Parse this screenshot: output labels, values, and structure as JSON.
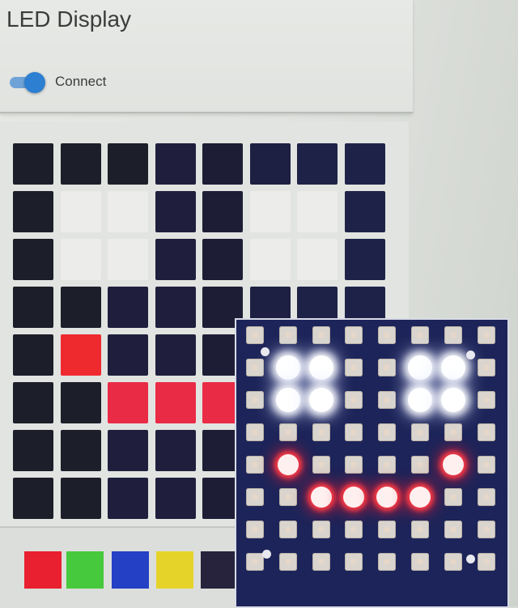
{
  "app": {
    "title": "LED Display",
    "connect_label": "Connect",
    "connect_on": true
  },
  "grid": {
    "rows": 8,
    "cols": 8,
    "colors": [
      [
        "#1c1e29",
        "#1c1e29",
        "#1c1e29",
        "#1f1f3d",
        "#1d1d36",
        "#1d2042",
        "#1e2247",
        "#1f2248"
      ],
      [
        "#1c1e29",
        "#ececea",
        "#ececea",
        "#1f1f3d",
        "#1d1d36",
        "#ececea",
        "#ececea",
        "#1f2248"
      ],
      [
        "#1c1e29",
        "#ececea",
        "#ececea",
        "#1f1f3d",
        "#1d1d36",
        "#ececea",
        "#ececea",
        "#1f2248"
      ],
      [
        "#1c1e29",
        "#1c1e29",
        "#1f1f3d",
        "#1f1f3d",
        "#1d1d36",
        "#1d2042",
        "#1e2247",
        "#1f2248"
      ],
      [
        "#1c1e29",
        "#ef2a2f",
        "#1f1f3d",
        "#1f1f3d",
        "#1d1d36",
        "#1d2042",
        "#ef2a2f",
        "#1f2248"
      ],
      [
        "#1c1e29",
        "#1c1e29",
        "#ea2b45",
        "#ea2b45",
        "#ea2b45",
        "#ea2b45",
        "#1e2247",
        "#1f2248"
      ],
      [
        "#1c1e29",
        "#1c1e29",
        "#1f1f3d",
        "#1f1f3d",
        "#1d1d36",
        "#1d2042",
        "#1e2247",
        "#1f2248"
      ],
      [
        "#1c1e29",
        "#1c1e29",
        "#1f1f3d",
        "#1f1f3d",
        "#1d1d36",
        "#1d2042",
        "#1e2247",
        "#1f2248"
      ]
    ]
  },
  "palette": [
    {
      "name": "red",
      "color": "#e8202f"
    },
    {
      "name": "green",
      "color": "#46c93c"
    },
    {
      "name": "blue",
      "color": "#2440c4"
    },
    {
      "name": "yellow",
      "color": "#e6d32a"
    },
    {
      "name": "off",
      "color": "#27233d"
    }
  ],
  "led_matrix": {
    "states": [
      [
        "off",
        "off",
        "off",
        "off",
        "off",
        "off",
        "off",
        "off"
      ],
      [
        "off",
        "white",
        "white",
        "off",
        "off",
        "white",
        "white",
        "off"
      ],
      [
        "off",
        "white",
        "white",
        "off",
        "off",
        "white",
        "white",
        "off"
      ],
      [
        "off",
        "off",
        "off",
        "off",
        "off",
        "off",
        "off",
        "off"
      ],
      [
        "off",
        "red",
        "off",
        "off",
        "off",
        "off",
        "red",
        "off"
      ],
      [
        "off",
        "off",
        "red",
        "red",
        "red",
        "red",
        "off",
        "off"
      ],
      [
        "off",
        "off",
        "off",
        "off",
        "off",
        "off",
        "off",
        "off"
      ],
      [
        "off",
        "off",
        "off",
        "off",
        "off",
        "off",
        "off",
        "off"
      ]
    ]
  }
}
